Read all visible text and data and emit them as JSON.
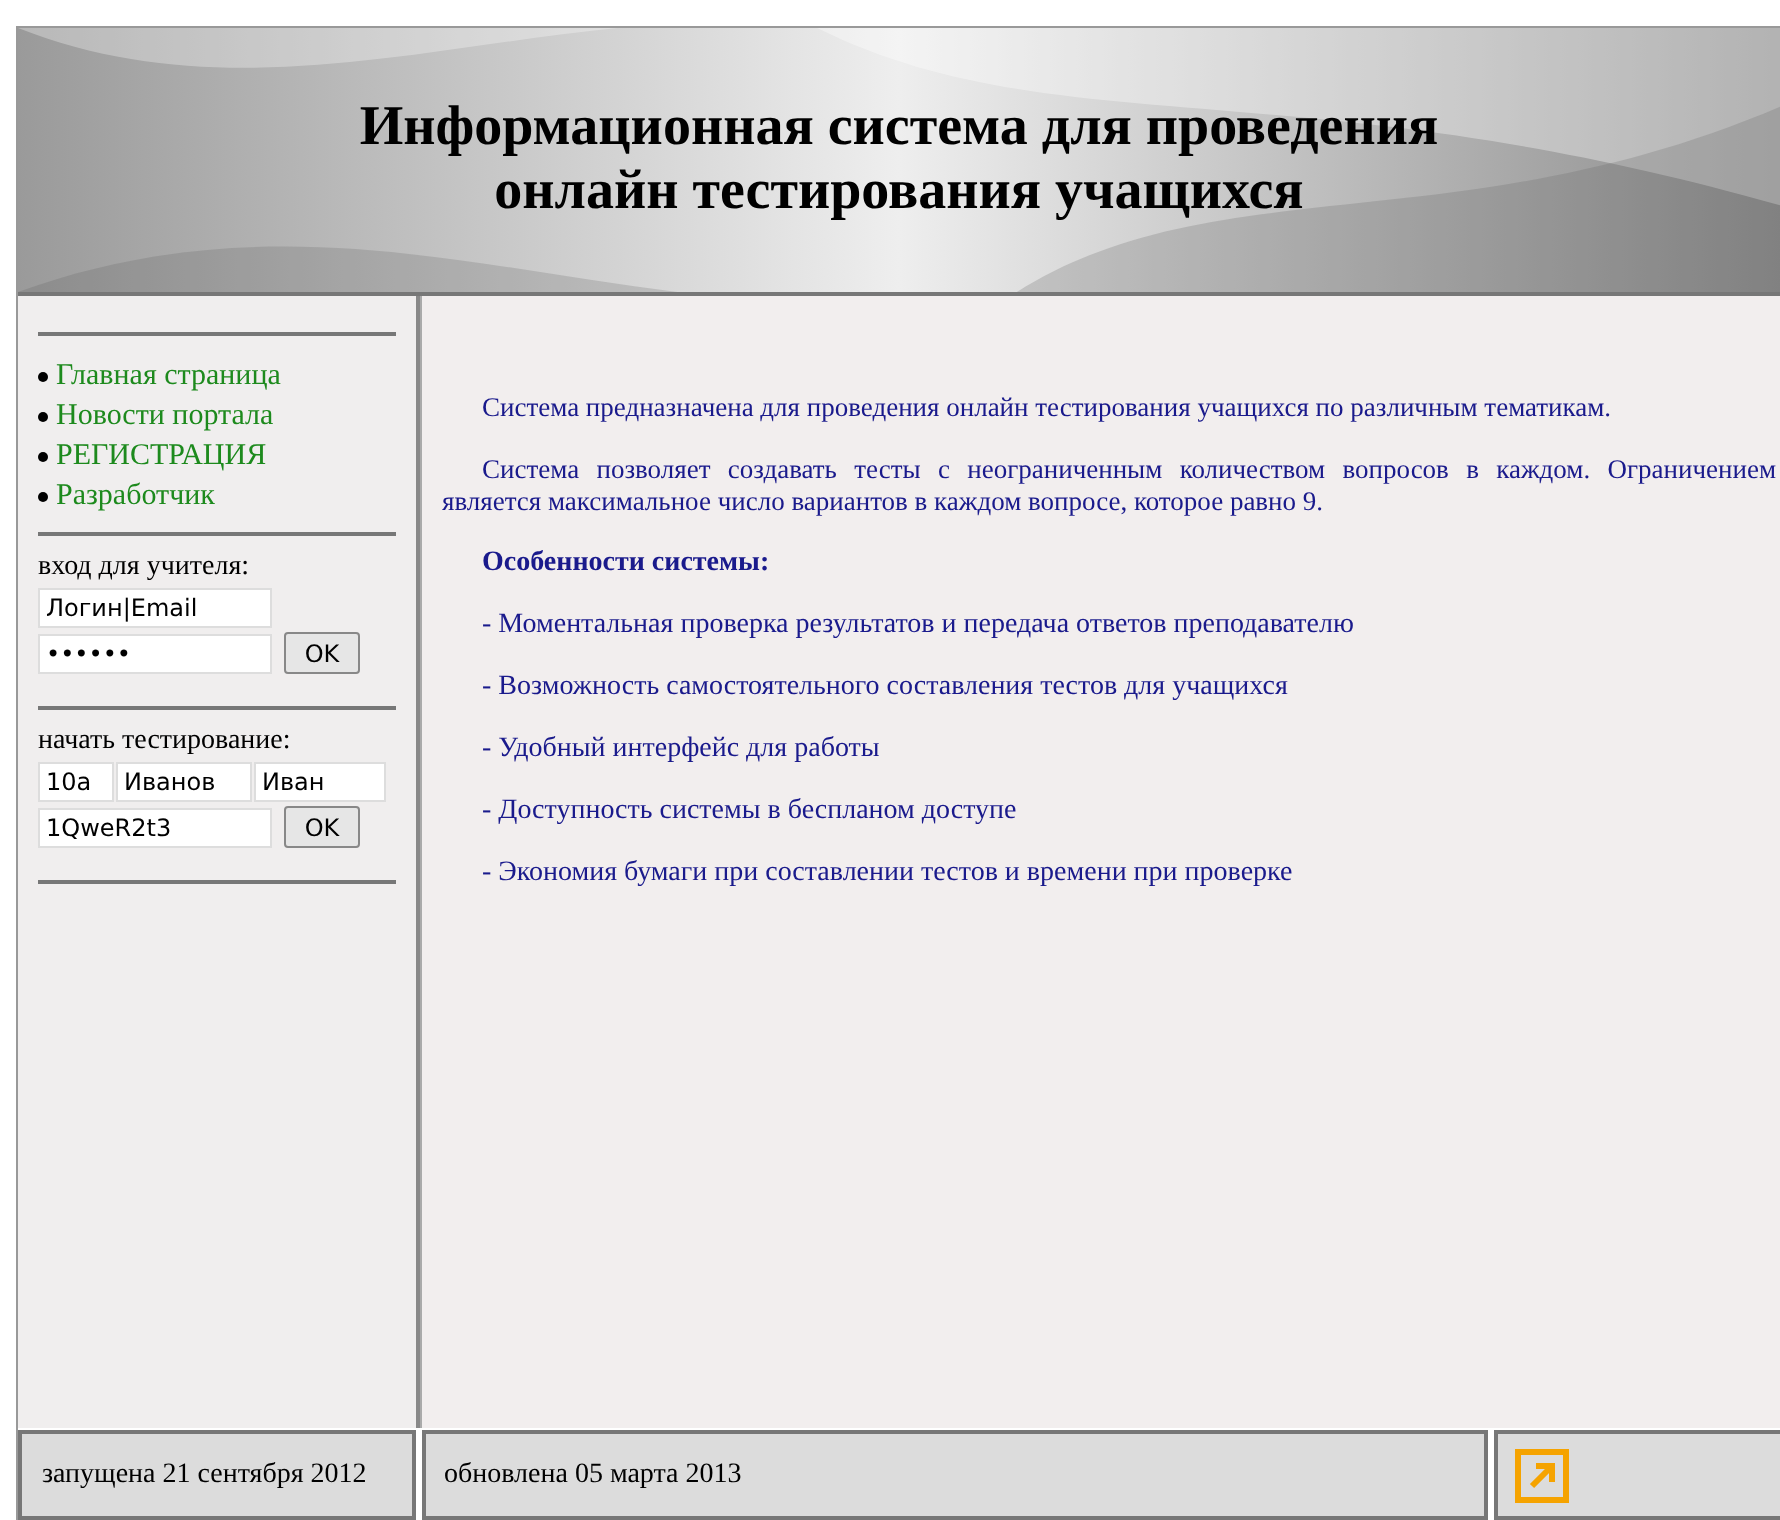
{
  "header": {
    "title_lines": [
      "Информационная система для проведения",
      "онлайн тестирования учащихся"
    ]
  },
  "sidebar": {
    "nav": [
      {
        "label": "Главная страница"
      },
      {
        "label": "Новости портала"
      },
      {
        "label": "РЕГИСТРАЦИЯ"
      },
      {
        "label": "Разработчик"
      }
    ],
    "teacher_login": {
      "label": "вход для учителя:",
      "login": "Логин|Email",
      "password": "••••••",
      "button": "OK"
    },
    "start_test": {
      "label": "начать тестирование:",
      "class": "10а",
      "surname": "Иванов",
      "name": "Иван",
      "code": "1QweR2t3",
      "button": "OK"
    }
  },
  "main": {
    "paragraphs": [
      {
        "kind": "text",
        "text": "Система предназначена для проведения онлайн тестирования учащихся по различным тематикам."
      },
      {
        "kind": "text",
        "text": "Система позволяет создавать тесты с неограниченным количеством вопросов в каждом. Ограничением является максимальное число вариантов в каждом вопросе, которое равно 9."
      },
      {
        "kind": "heading",
        "text": "Особенности системы:"
      },
      {
        "kind": "item",
        "text": "- Моментальная проверка результатов и передача ответов преподавателю"
      },
      {
        "kind": "item",
        "text": "- Возможность самостоятельного составления тестов для учащихся"
      },
      {
        "kind": "item",
        "text": "- Удобный интерфейс для работы"
      },
      {
        "kind": "item",
        "text": "- Доступность системы в беспланом доступе"
      },
      {
        "kind": "item",
        "text": "- Экономия бумаги при составлении тестов и времени при проверке"
      }
    ]
  },
  "footer": {
    "launched": "запущена 21 сентября 2012",
    "updated": "обновлена 05 марта 2013"
  }
}
